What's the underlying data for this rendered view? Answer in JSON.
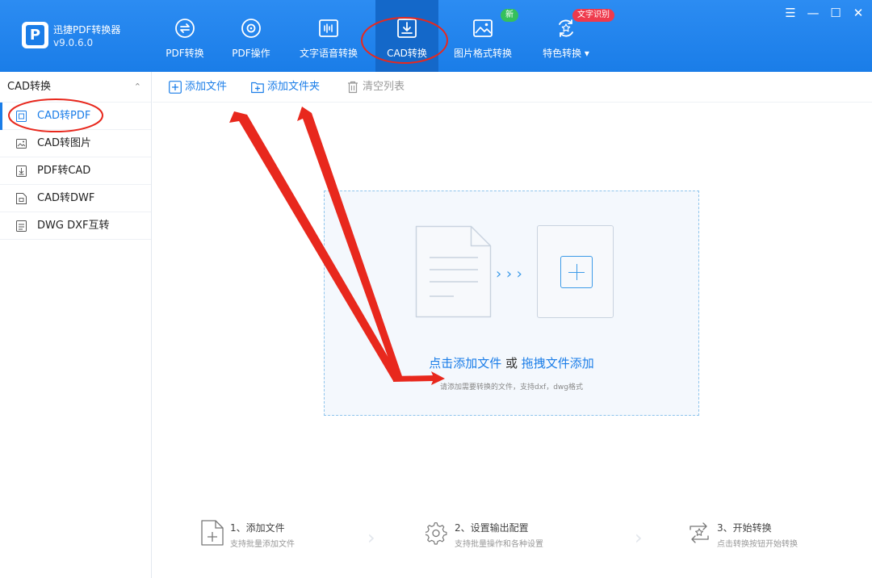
{
  "app": {
    "name": "迅捷PDF转换器",
    "version": "v9.0.6.0"
  },
  "nav": [
    {
      "label": "PDF转换",
      "icon": "pdf-convert-icon"
    },
    {
      "label": "PDF操作",
      "icon": "pdf-operate-icon"
    },
    {
      "label": "文字语音转换",
      "icon": "audio-wave-icon"
    },
    {
      "label": "CAD转换",
      "icon": "cad-convert-icon",
      "active": true
    },
    {
      "label": "图片格式转换",
      "icon": "image-icon",
      "badge": "新"
    },
    {
      "label": "特色转换",
      "icon": "special-convert-icon",
      "badge": "文字识别",
      "dropdown": "▾"
    }
  ],
  "window_controls": {
    "menu": "☰",
    "minimize": "—",
    "maximize": "☐",
    "close": "✕"
  },
  "sidebar": {
    "title": "CAD转换",
    "collapse": "⌃",
    "items": [
      {
        "label": "CAD转PDF",
        "active": true,
        "icon": "pdf-file-icon"
      },
      {
        "label": "CAD转图片",
        "icon": "image-file-icon"
      },
      {
        "label": "PDF转CAD",
        "icon": "cad-file-icon"
      },
      {
        "label": "CAD转DWF",
        "icon": "dwf-file-icon"
      },
      {
        "label": "DWG DXF互转",
        "icon": "dwg-file-icon"
      }
    ]
  },
  "toolbar": {
    "add_file": "添加文件",
    "add_folder": "添加文件夹",
    "clear_list": "清空列表"
  },
  "dropzone": {
    "arrows": "›››",
    "click_add": "点击添加文件",
    "or": "或",
    "drag_add": "拖拽文件添加",
    "hint": "请添加需要转换的文件，支持dxf，dwg格式"
  },
  "steps": [
    {
      "title": "1、添加文件",
      "desc": "支持批量添加文件",
      "icon": "add-file-icon"
    },
    {
      "title": "2、设置输出配置",
      "desc": "支持批量操作和各种设置",
      "icon": "settings-gear-icon"
    },
    {
      "title": "3、开始转换",
      "desc": "点击转换按钮开始转换",
      "icon": "convert-start-icon"
    }
  ],
  "colors": {
    "header": "#1a7de8",
    "accent": "#1a7de8",
    "annotation": "#e8281d",
    "badge_new": "#35c05b",
    "badge_ocr": "#ef3a4c"
  }
}
